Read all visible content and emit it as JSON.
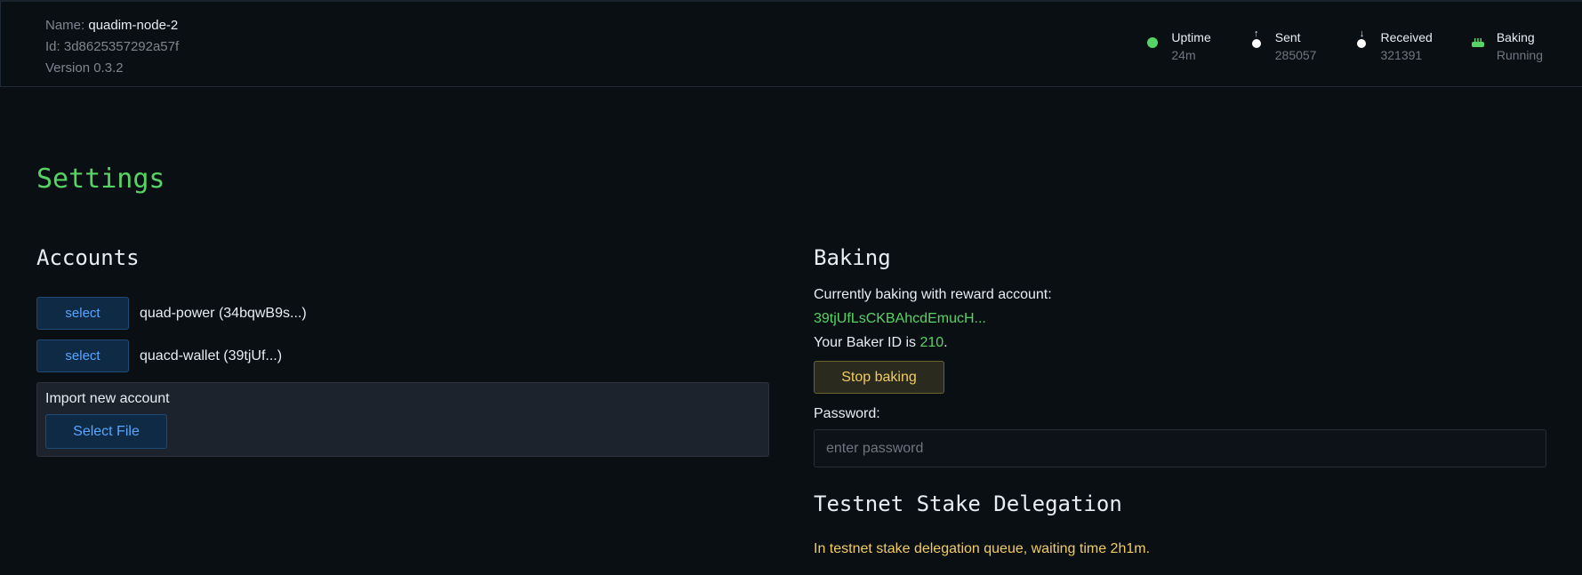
{
  "node": {
    "name_label": "Name:",
    "name": "quadim-node-2",
    "id_label": "Id:",
    "id": "3d8625357292a57f",
    "version_label": "Version",
    "version": "0.3.2"
  },
  "stats": {
    "uptime": {
      "label": "Uptime",
      "value": "24m"
    },
    "sent": {
      "label": "Sent",
      "value": "285057"
    },
    "received": {
      "label": "Received",
      "value": "321391"
    },
    "baking": {
      "label": "Baking",
      "value": "Running"
    }
  },
  "page_title": "Settings",
  "accounts": {
    "heading": "Accounts",
    "items": [
      {
        "button": "select",
        "name": "quad-power (34bqwB9s...)"
      },
      {
        "button": "select",
        "name": "quacd-wallet (39tjUf...)"
      }
    ],
    "import_label": "Import new account",
    "import_button": "Select File"
  },
  "baking": {
    "heading": "Baking",
    "reward_text": "Currently baking with reward account:",
    "reward_account": "39tjUfLsCKBAhcdEmucH...",
    "baker_id_prefix": "Your Baker ID is",
    "baker_id": "210",
    "baker_id_suffix": ".",
    "stop_button": "Stop baking",
    "password_label": "Password:",
    "password_placeholder": "enter password"
  },
  "delegation": {
    "heading": "Testnet Stake Delegation",
    "status": "In testnet stake delegation queue, waiting time 2h1m."
  },
  "colors": {
    "accent_green": "#56d364",
    "link_blue": "#58a6ff",
    "warning_yellow": "#f2cc60",
    "background": "#0a0f14"
  }
}
